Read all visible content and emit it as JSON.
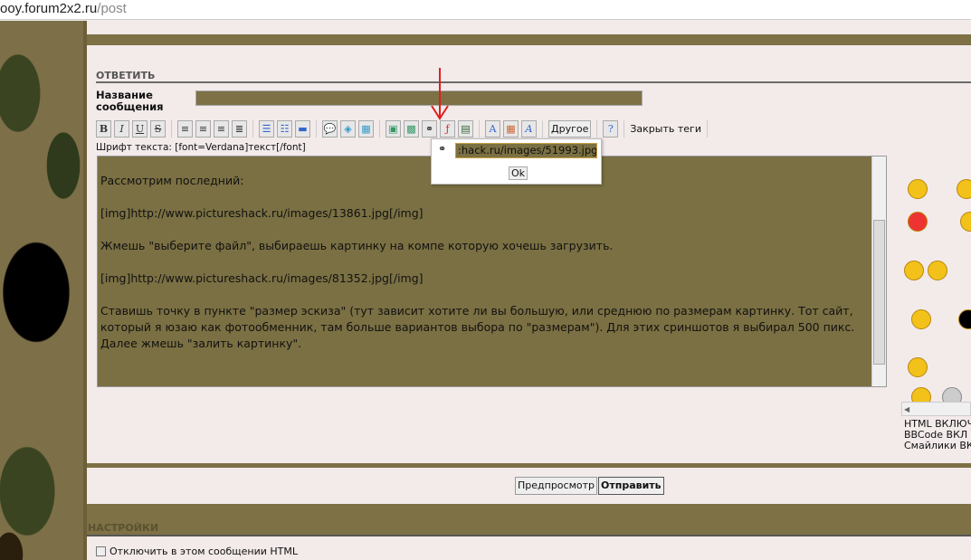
{
  "browser": {
    "url_host": "ooy.forum2x2.ru",
    "url_path": "/post"
  },
  "reply": {
    "section_title": "ОТВЕТИТЬ",
    "title_label_1": "Название",
    "title_label_2": "сообщения",
    "title_value": ""
  },
  "toolbar": {
    "bold": "B",
    "italic": "I",
    "underline": "U",
    "strike": "S",
    "other_label": "Другое",
    "close_tags_label": "Закрыть теги",
    "font_hint": "Шрифт текста: [font=Verdana]текст[/font]"
  },
  "editor": {
    "lines": [
      "Рассмотрим последний:",
      "[img]http://www.pictureshack.ru/images/13861.jpg[/img]",
      "Жмешь \"выберите файл\", выбираешь картинку на компе которую хочешь загрузить.",
      "[img]http://www.pictureshack.ru/images/81352.jpg[/img]",
      "Ставишь точку в пункте \"размер эскиза\" (тут зависит хотите ли вы большую, или среднюю по размерам картинку. Тот сайт, который я юзаю как фотообменник, там больше вариантов выбора по \"размерам\"). Для этих сриншотов я выбирал 500 пикс. Далее жмешь \"залить картинку\"."
    ]
  },
  "image_popup": {
    "url_value": ":hack.ru/images/51993.jpg",
    "ok_label": "Ok"
  },
  "status": {
    "html": "HTML ВКЛЮЧ",
    "bbcode": "BBCode ВКЛ",
    "smilies": "Смайлики ВК"
  },
  "buttons": {
    "preview": "Предпросмотр",
    "submit": "Отправить"
  },
  "settings": {
    "section_title": "НАСТРОЙКИ",
    "disable_html": "Отключить в этом сообщении HTML"
  },
  "colors": {
    "olive": "#7d7145",
    "panel": "#f3eaea",
    "arrow": "#e02020"
  }
}
